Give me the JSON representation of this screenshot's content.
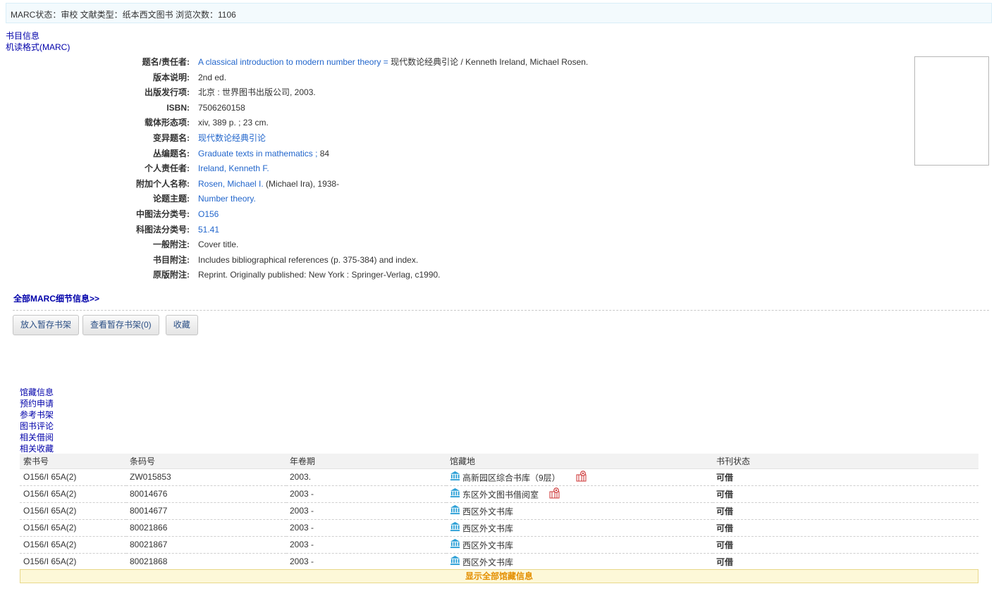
{
  "status_bar": "MARC状态：审校  文献类型：纸本西文图书  浏览次数：1106",
  "top_links": [
    "书目信息",
    "机读格式(MARC)"
  ],
  "bib": {
    "title_label": "题名/责任者:",
    "title_link": "A classical introduction to modern number theory =",
    "title_rest": " 现代数论经典引论 / Kenneth Ireland, Michael Rosen.",
    "edition_label": "版本说明:",
    "edition": "2nd ed.",
    "pub_label": "出版发行项:",
    "pub": "北京 : 世界图书出版公司, 2003.",
    "isbn_label": "ISBN:",
    "isbn": "7506260158",
    "phys_label": "载体形态项:",
    "phys": "xiv, 389 p. ; 23 cm.",
    "variant_label": "变异题名:",
    "variant": "现代数论经典引论",
    "series_label": "丛编题名:",
    "series_link": "Graduate texts in mathematics ;",
    "series_num": " 84",
    "author_label": "个人责任者:",
    "author": "Ireland, Kenneth F.",
    "added_label": "附加个人名称:",
    "added_link": "Rosen, Michael I.",
    "added_rest": " (Michael Ira), 1938-",
    "subject_label": "论题主题:",
    "subject": "Number theory.",
    "clc_label": "中图法分类号:",
    "clc": "O156",
    "kt_label": "科图法分类号:",
    "kt": "51.41",
    "note_label": "一般附注:",
    "note": "Cover title.",
    "bibnote_label": "书目附注:",
    "bibnote": "Includes bibliographical references (p. 375-384) and index.",
    "orig_label": "原版附注:",
    "orig": "Reprint. Originally published: New York : Springer-Verlag, c1990."
  },
  "all_marc_link": "全部MARC细节信息>>",
  "buttons": {
    "add_shelf": "放入暂存书架",
    "view_shelf": "查看暂存书架(0)",
    "collect": "收藏"
  },
  "tabs": [
    "馆藏信息",
    "预约申请",
    "参考书架",
    "图书评论",
    "相关借阅",
    "相关收藏"
  ],
  "holdings": {
    "headers": [
      "索书号",
      "条码号",
      "年卷期",
      "馆藏地",
      "书刊状态"
    ],
    "rows": [
      {
        "call": "O156/I 65A(2)",
        "barcode": "ZW015853",
        "year": "2003.",
        "loc": "高新园区综合书库（9层）",
        "map": true,
        "status": "可借"
      },
      {
        "call": "O156/I 65A(2)",
        "barcode": "80014676",
        "year": "2003 -",
        "loc": "东区外文图书借阅室",
        "map": true,
        "status": "可借"
      },
      {
        "call": "O156/I 65A(2)",
        "barcode": "80014677",
        "year": "2003 -",
        "loc": "西区外文书库",
        "map": false,
        "status": "可借"
      },
      {
        "call": "O156/I 65A(2)",
        "barcode": "80021866",
        "year": "2003 -",
        "loc": "西区外文书库",
        "map": false,
        "status": "可借"
      },
      {
        "call": "O156/I 65A(2)",
        "barcode": "80021867",
        "year": "2003 -",
        "loc": "西区外文书库",
        "map": false,
        "status": "可借"
      },
      {
        "call": "O156/I 65A(2)",
        "barcode": "80021868",
        "year": "2003 -",
        "loc": "西区外文书库",
        "map": false,
        "status": "可借"
      }
    ],
    "show_all": "显示全部馆藏信息"
  },
  "colors": {
    "link": "#2266cc",
    "nav_link": "#0000aa",
    "available": "#009900",
    "show_all": "#e48f00"
  }
}
